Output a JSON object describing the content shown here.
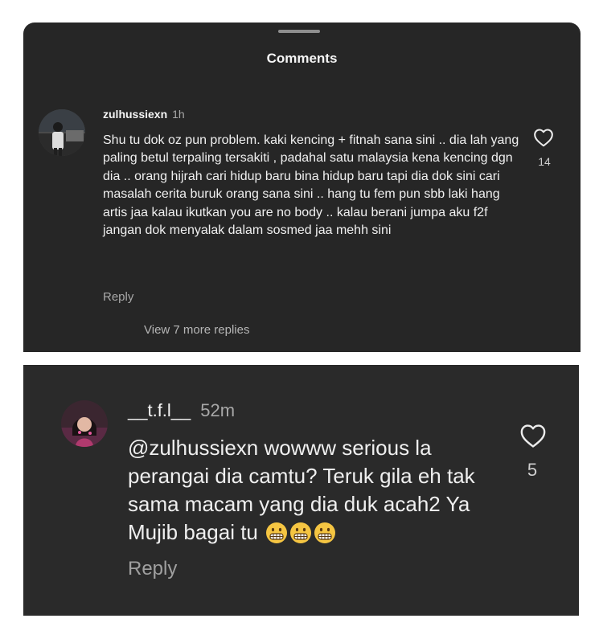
{
  "sheet": {
    "title": "Comments"
  },
  "comment1": {
    "username": "zulhussiexn",
    "time": "1h",
    "text": "Shu tu dok oz pun problem. kaki kencing + fitnah sana sini .. dia lah yang paling betul terpaling tersakiti , padahal satu malaysia kena kencing dgn dia .. orang hijrah cari hidup baru bina hidup baru tapi dia dok sini cari masalah cerita buruk orang sana sini .. hang tu fem pun sbb laki hang artis jaa kalau ikutkan you are no body .. kalau berani jumpa aku f2f jangan dok menyalak dalam sosmed jaa mehh sini",
    "like_count": "14",
    "reply_label": "Reply",
    "view_replies_label": "View 7 more replies",
    "heart_icon": "heart-outline-icon"
  },
  "comment2": {
    "username": "__t.f.l__",
    "time": "52m",
    "text": "@zulhussiexn wowww serious la perangai dia camtu? Teruk gila eh tak sama macam yang dia duk acah2 Ya Mujib bagai tu",
    "emojis": [
      "grimacing-face-emoji",
      "grimacing-face-emoji",
      "grimacing-face-emoji"
    ],
    "like_count": "5",
    "reply_label": "Reply",
    "heart_icon": "heart-outline-icon"
  },
  "colors": {
    "panel_bg": "#262626",
    "text": "#f2f2f2",
    "muted": "#a8a8a8",
    "emoji_yellow": "#f5c542"
  }
}
